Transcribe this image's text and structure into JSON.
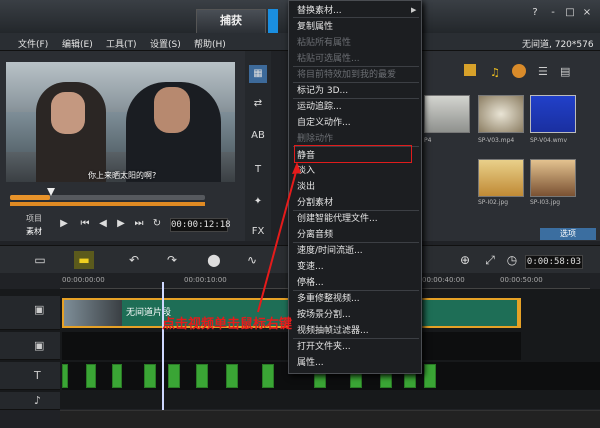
{
  "header": {
    "tab_capture": "捕获",
    "window_title": "无间道, 720*576",
    "controls": [
      "?",
      "-",
      "□",
      "×"
    ]
  },
  "menubar": [
    "文件(F)",
    "编辑(E)",
    "工具(T)",
    "设置(S)",
    "帮助(H)"
  ],
  "preview": {
    "subtitle": "你上来晒太阳的啊?",
    "mode_project": "项目",
    "mode_clip": "素材",
    "timecode": "00:00:12:18"
  },
  "library": {
    "thumb_labels": [
      "P4",
      "SP-V03.mp4",
      "SP-V04.wmv",
      "SP-I02.jpg",
      "SP-I03.jpg"
    ],
    "options_label": "选项"
  },
  "timeline": {
    "total_time": "0:00:58:03",
    "ruler": [
      "00:00:00:00",
      "00:00:10:00",
      "00:00:40:00",
      "00:00:50:00"
    ],
    "video_clip_label": "无间道片段"
  },
  "context_menu": {
    "items": [
      {
        "label": "替换素材...",
        "disabled": false,
        "submenu": true
      },
      {
        "label": "复制属性",
        "disabled": false
      },
      {
        "label": "粘贴所有属性",
        "disabled": true
      },
      {
        "label": "粘贴可选属性...",
        "disabled": true
      },
      {
        "label": "将目前特效加到我的最爱",
        "disabled": true
      },
      {
        "label": "标记为 3D...",
        "disabled": false
      },
      {
        "label": "运动追踪...",
        "disabled": false
      },
      {
        "label": "自定义动作...",
        "disabled": false
      },
      {
        "label": "删除动作",
        "disabled": true
      },
      {
        "label": "静音",
        "disabled": false
      },
      {
        "label": "淡入",
        "disabled": false
      },
      {
        "label": "淡出",
        "disabled": false
      },
      {
        "label": "分割素材",
        "disabled": false
      },
      {
        "label": "创建智能代理文件...",
        "disabled": false
      },
      {
        "label": "分离音频",
        "disabled": false
      },
      {
        "label": "速度/时间流逝...",
        "disabled": false
      },
      {
        "label": "变速...",
        "disabled": false
      },
      {
        "label": "停格...",
        "disabled": false
      },
      {
        "label": "多重修整视频...",
        "disabled": false
      },
      {
        "label": "按场景分割...",
        "disabled": false
      },
      {
        "label": "视频抽帧过滤器...",
        "disabled": false
      },
      {
        "label": "打开文件夹...",
        "disabled": false
      },
      {
        "label": "属性...",
        "disabled": false
      }
    ],
    "highlighted": "静音"
  },
  "annotation": {
    "text": "点击视频单击鼠标右键",
    "color": "#e51b1b"
  },
  "colors": {
    "accent": "#1a8ee0",
    "clip_border": "#e6a126",
    "clip_fill": "#1e6e56",
    "title_clip": "#3aa535"
  }
}
